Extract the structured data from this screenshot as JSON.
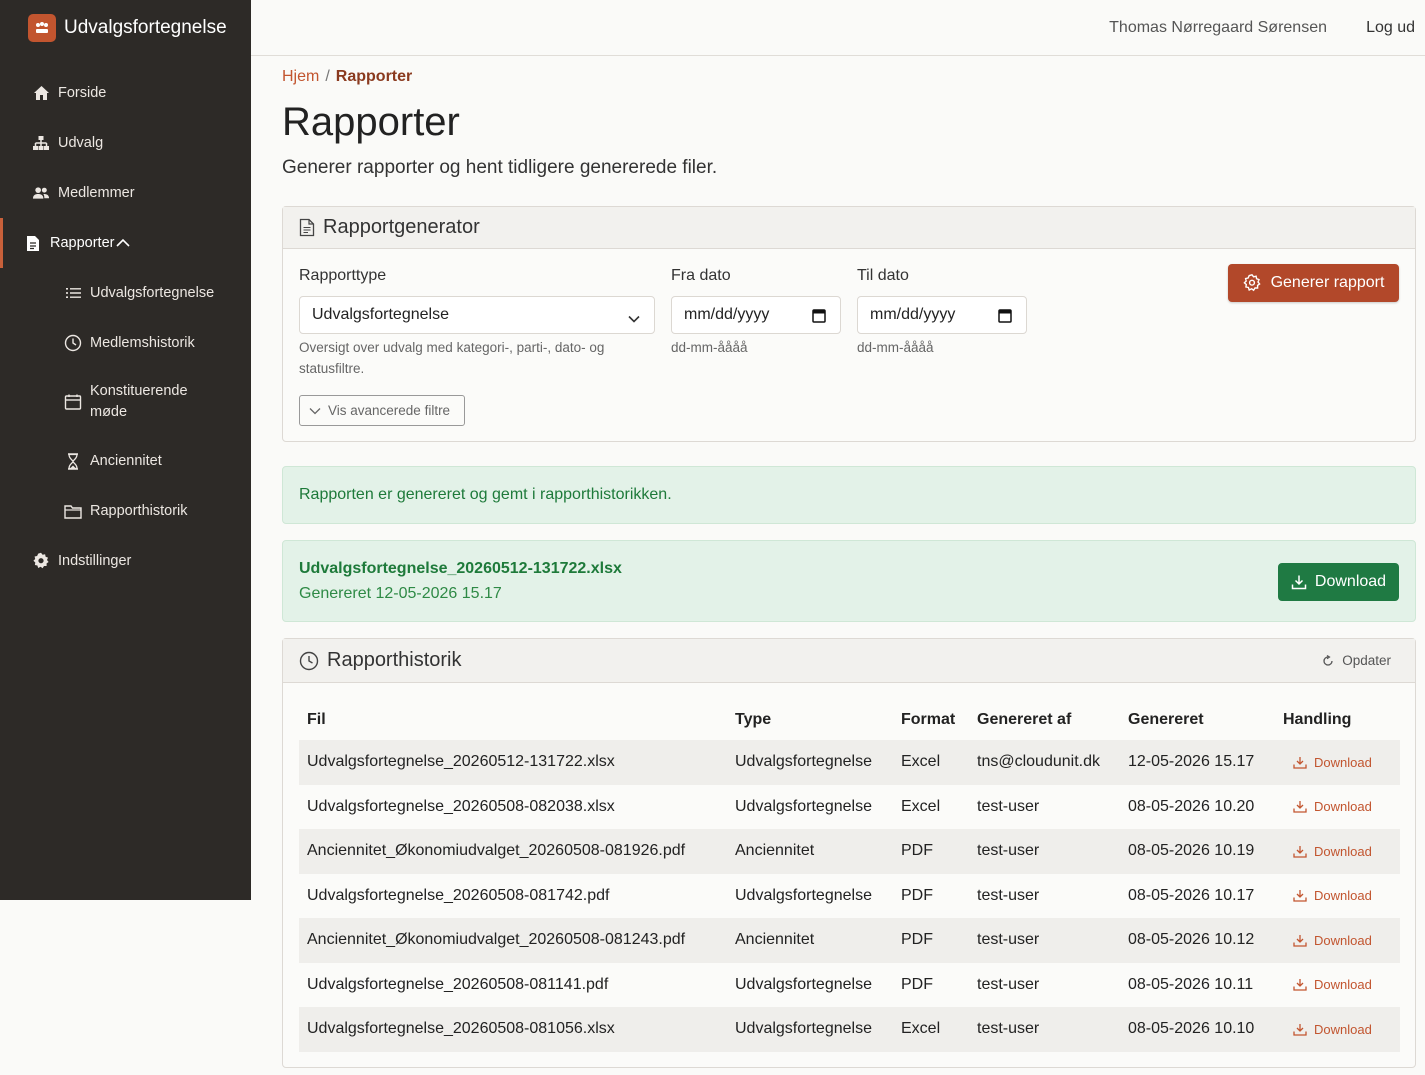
{
  "app": {
    "title": "Udvalgsfortegnelse"
  },
  "topbar": {
    "user": "Thomas Nørregaard Sørensen",
    "logout": "Log ud"
  },
  "sidebar": {
    "items": [
      {
        "label": "Forside",
        "icon": "home-icon"
      },
      {
        "label": "Udvalg",
        "icon": "org-chart-icon"
      },
      {
        "label": "Medlemmer",
        "icon": "users-icon"
      },
      {
        "label": "Rapporter",
        "icon": "document-icon"
      }
    ],
    "subitems": [
      {
        "label": "Udvalgsfortegnelse",
        "icon": "list-icon"
      },
      {
        "label": "Medlemshistorik",
        "icon": "clock-icon"
      },
      {
        "label": "Konstituerende møde",
        "icon": "calendar-icon"
      },
      {
        "label": "Anciennitet",
        "icon": "hourglass-icon"
      },
      {
        "label": "Rapporthistorik",
        "icon": "folder-icon"
      }
    ],
    "settings": {
      "label": "Indstillinger",
      "icon": "gear-icon"
    }
  },
  "breadcrumb": {
    "home": "Hjem",
    "separator": "/",
    "current": "Rapporter"
  },
  "page": {
    "title": "Rapporter",
    "subtitle": "Generer rapporter og hent tidligere genererede filer."
  },
  "generator": {
    "header": "Rapportgenerator",
    "type_label": "Rapporttype",
    "type_value": "Udvalgsfortegnelse",
    "type_hint": "Oversigt over udvalg med kategori-, parti-, dato- og statusfiltre.",
    "from_label": "Fra dato",
    "from_placeholder": "mm/dd/yyyy",
    "from_hint": "dd-mm-åååå",
    "to_label": "Til dato",
    "to_placeholder": "mm/dd/yyyy",
    "to_hint": "dd-mm-åååå",
    "advanced_label": "Vis avancerede filtre",
    "generate_label": "Generer rapport"
  },
  "alert": {
    "message": "Rapporten er genereret og gemt i rapporthistorikken."
  },
  "latest": {
    "filename": "Udvalgsfortegnelse_20260512-131722.xlsx",
    "generated": "Genereret 12-05-2026 15.17",
    "download_label": "Download"
  },
  "history": {
    "header": "Rapporthistorik",
    "refresh_label": "Opdater",
    "columns": [
      "Fil",
      "Type",
      "Format",
      "Genereret af",
      "Genereret",
      "Handling"
    ],
    "rows": [
      {
        "file": "Udvalgsfortegnelse_20260512-131722.xlsx",
        "type": "Udvalgsfortegnelse",
        "format": "Excel",
        "by": "tns@cloudunit.dk",
        "date": "12-05-2026 15.17",
        "action": "Download"
      },
      {
        "file": "Udvalgsfortegnelse_20260508-082038.xlsx",
        "type": "Udvalgsfortegnelse",
        "format": "Excel",
        "by": "test-user",
        "date": "08-05-2026 10.20",
        "action": "Download"
      },
      {
        "file": "Anciennitet_Økonomiudvalget_20260508-081926.pdf",
        "type": "Anciennitet",
        "format": "PDF",
        "by": "test-user",
        "date": "08-05-2026 10.19",
        "action": "Download"
      },
      {
        "file": "Udvalgsfortegnelse_20260508-081742.pdf",
        "type": "Udvalgsfortegnelse",
        "format": "PDF",
        "by": "test-user",
        "date": "08-05-2026 10.17",
        "action": "Download"
      },
      {
        "file": "Anciennitet_Økonomiudvalget_20260508-081243.pdf",
        "type": "Anciennitet",
        "format": "PDF",
        "by": "test-user",
        "date": "08-05-2026 10.12",
        "action": "Download"
      },
      {
        "file": "Udvalgsfortegnelse_20260508-081141.pdf",
        "type": "Udvalgsfortegnelse",
        "format": "PDF",
        "by": "test-user",
        "date": "08-05-2026 10.11",
        "action": "Download"
      },
      {
        "file": "Udvalgsfortegnelse_20260508-081056.xlsx",
        "type": "Udvalgsfortegnelse",
        "format": "Excel",
        "by": "test-user",
        "date": "08-05-2026 10.10",
        "action": "Download"
      }
    ]
  },
  "colors": {
    "sidebar_bg": "#2d2a27",
    "accent": "#c2552f",
    "primary_button": "#b2482a",
    "success_bg": "#e3f2e8",
    "success_text": "#1e7a3a",
    "download_button": "#1f7a43"
  }
}
